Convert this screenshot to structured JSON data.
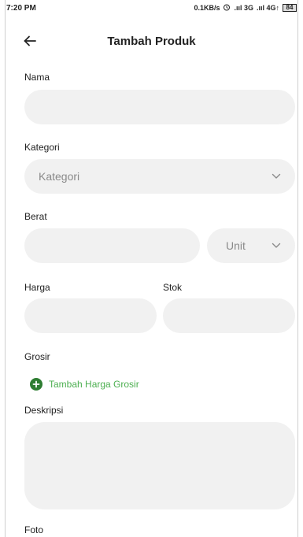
{
  "status_bar": {
    "time": "7:20 PM",
    "network_speed": "0.1KB/s",
    "alarm_icon": "alarm-icon",
    "signal_1": ".ııl 3G",
    "signal_2": ".ııl 4G↑",
    "battery": "84"
  },
  "header": {
    "title": "Tambah Produk",
    "back_icon": "arrow-left-icon"
  },
  "form": {
    "nama": {
      "label": "Nama",
      "value": ""
    },
    "kategori": {
      "label": "Kategori",
      "selected": "Kategori"
    },
    "berat": {
      "label": "Berat",
      "value": "",
      "unit_selected": "Unit"
    },
    "harga": {
      "label": "Harga",
      "value": ""
    },
    "stok": {
      "label": "Stok",
      "value": ""
    },
    "grosir": {
      "label": "Grosir",
      "add_label": "Tambah Harga Grosir",
      "add_icon": "plus-circle-icon"
    },
    "deskripsi": {
      "label": "Deskripsi",
      "value": ""
    },
    "foto": {
      "label": "Foto"
    }
  },
  "colors": {
    "accent_green": "#4caf50",
    "icon_green": "#2e7d32",
    "field_bg": "#f1f1f1",
    "placeholder": "#8a8a8a"
  }
}
